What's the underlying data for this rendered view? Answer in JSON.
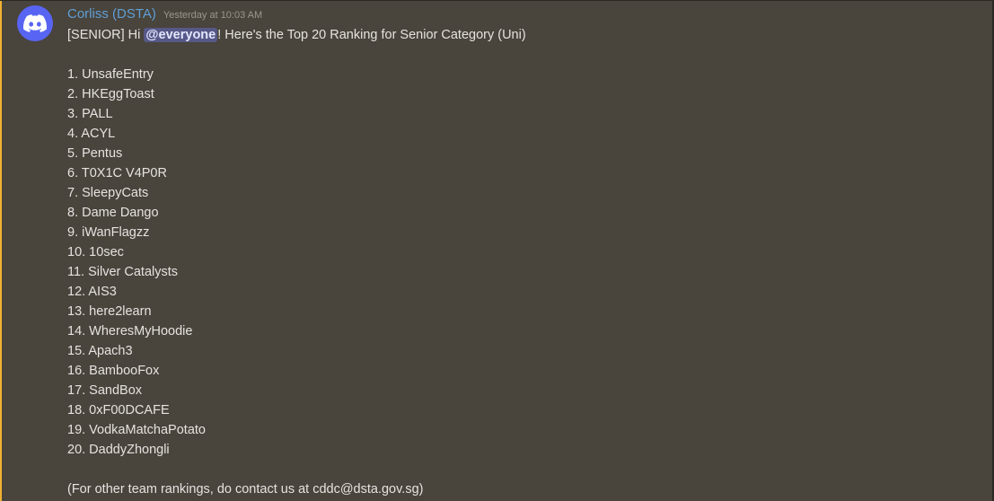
{
  "message": {
    "username": "Corliss (DSTA)",
    "timestamp": "Yesterday at 10:03 AM",
    "intro_prefix": "[SENIOR] Hi ",
    "mention": "@everyone",
    "intro_suffix": "! Here's the Top 20 Ranking for Senior Category (Uni)",
    "rankings": [
      "1. UnsafeEntry",
      "2. HKEggToast",
      "3. PALL",
      "4. ACYL",
      "5. Pentus",
      "6. T0X1C V4P0R",
      "7. SleepyCats",
      "8. Dame Dango",
      "9. iWanFlagzz",
      "10. 10sec",
      "11. Silver Catalysts",
      "12. AIS3",
      "13. here2learn",
      "14. WheresMyHoodie",
      "15. Apach3",
      "16. BambooFox",
      "17. SandBox",
      "18. 0xF00DCAFE",
      "19. VodkaMatchaPotato",
      "20. DaddyZhongli"
    ],
    "footer": "(For other team rankings, do contact us at cddc@dsta.gov.sg)"
  },
  "icons": {
    "avatar": "discord-logo-icon"
  },
  "colors": {
    "background": "#49443c",
    "username": "#5f9fd6",
    "mention_bg": "#565887",
    "avatar_bg": "#5865f2",
    "highlight_bar": "#f0b232"
  }
}
